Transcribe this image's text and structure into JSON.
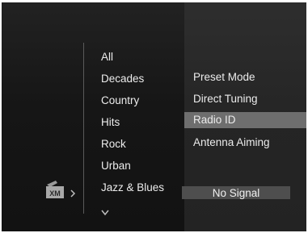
{
  "categories": {
    "items": [
      {
        "label": "All"
      },
      {
        "label": "Decades"
      },
      {
        "label": "Country"
      },
      {
        "label": "Hits"
      },
      {
        "label": "Rock"
      },
      {
        "label": "Urban"
      },
      {
        "label": "Jazz & Blues"
      }
    ]
  },
  "source_icon": {
    "name": "xm-radio-icon",
    "label": "XM"
  },
  "menu": {
    "items": [
      {
        "label": "Preset Mode"
      },
      {
        "label": "Direct Tuning"
      },
      {
        "label": "Radio ID",
        "selected": true
      },
      {
        "label": "Antenna Aiming"
      }
    ]
  },
  "status": {
    "signal_text": "No Signal"
  },
  "colors": {
    "background": "#1e1e1e",
    "text": "#ececec",
    "selection": "#6e6e6e",
    "status_bar": "#4e4e4e"
  }
}
